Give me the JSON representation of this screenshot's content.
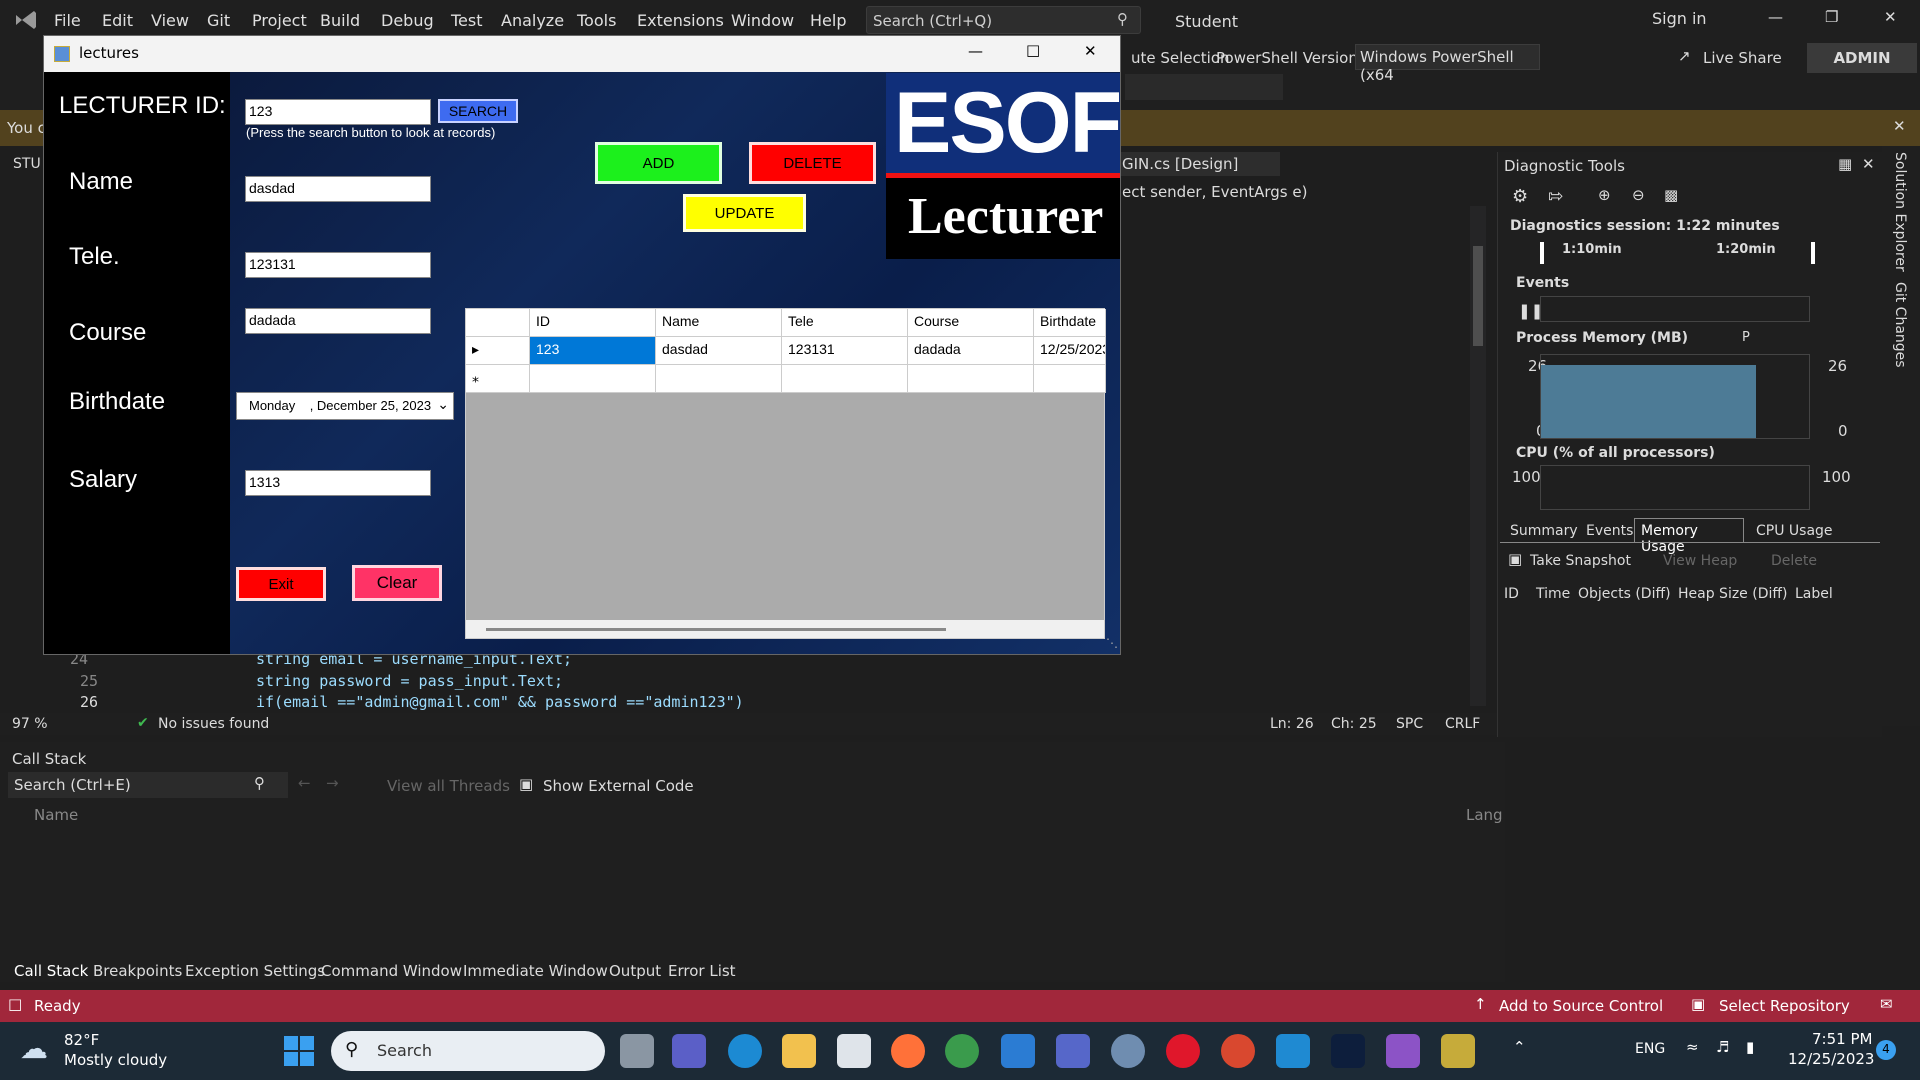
{
  "vs": {
    "menu": [
      "File",
      "Edit",
      "View",
      "Git",
      "Project",
      "Build",
      "Debug",
      "Test",
      "Analyze",
      "Tools",
      "Extensions",
      "Window",
      "Help"
    ],
    "search_placeholder": "Search (Ctrl+Q)",
    "solution_name": "Student",
    "sign_in": "Sign in",
    "admin_badge": "ADMIN",
    "toolbar": {
      "ute_selection": "ute Selection",
      "ps_version_label": "PowerShell Version:",
      "ps_version_value": "Windows PowerShell (x64",
      "live_share": "Live Share"
    },
    "info_bar_text": "You c",
    "tab_left": "STU",
    "doc_tab": "GIN.cs [Design]",
    "method_dropdown": "ect sender, EventArgs e)",
    "code": {
      "lines": [
        {
          "num": "24",
          "text": "string email = username_input.Text;"
        },
        {
          "num": "25",
          "text": "string password = pass_input.Text;"
        },
        {
          "num": "26",
          "text": "if(email ==\"admin@gmail.com\" && password ==\"admin123\")"
        }
      ]
    },
    "editor_status": {
      "zoom": "97 %",
      "issues": "No issues found",
      "ln": "Ln: 26",
      "ch": "Ch: 25",
      "spc": "SPC",
      "crlf": "CRLF"
    },
    "diagnostics": {
      "title": "Diagnostic Tools",
      "session": "Diagnostics session: 1:22 minutes",
      "tick1": "1:10min",
      "tick2": "1:20min",
      "events": "Events",
      "process_memory": "Process Memory (MB)",
      "mem_legend_p": "P",
      "mem_max": "26",
      "mem_min": "0",
      "cpu": "CPU (% of all processors)",
      "cpu_max": "100",
      "tabs": [
        "Summary",
        "Events",
        "Memory Usage",
        "CPU Usage"
      ],
      "take_snapshot": "Take Snapshot",
      "view_heap": "View Heap",
      "delete": "Delete",
      "columns": [
        "ID",
        "Time",
        "Objects (Diff)",
        "Heap Size (Diff)",
        "Label"
      ]
    },
    "side_tabs": [
      "Solution Explorer",
      "Git Changes"
    ],
    "callstack": {
      "title": "Call Stack",
      "search": "Search (Ctrl+E)",
      "view_all_threads": "View all Threads",
      "show_external": "Show External Code",
      "col_name": "Name",
      "col_lang": "Lang",
      "bottom_tabs": [
        "Call Stack",
        "Breakpoints",
        "Exception Settings",
        "Command Window",
        "Immediate Window",
        "Output",
        "Error List"
      ]
    },
    "statusbar": {
      "ready": "Ready",
      "add_source": "Add to Source Control",
      "select_repo": "Select Repository"
    }
  },
  "form": {
    "title": "lectures",
    "labels": {
      "lecturer_id": "LECTURER ID:",
      "name": "Name",
      "tele": "Tele.",
      "course": "Course",
      "birthdate": "Birthdate",
      "salary": "Salary"
    },
    "values": {
      "id": "123",
      "name": "dasdad",
      "tele": "123131",
      "course": "dadada",
      "birthdate": "Monday    , December 25, 2023",
      "salary": "1313"
    },
    "hint": "(Press the search button to look at records)",
    "buttons": {
      "search": "SEARCH",
      "add": "ADD",
      "delete": "DELETE",
      "update": "UPDATE",
      "exit": "Exit",
      "clear": "Clear"
    },
    "banner": {
      "top": "ESOF",
      "bottom": "Lecturer"
    },
    "grid": {
      "columns": [
        "ID",
        "Name",
        "Tele",
        "Course",
        "Birthdate"
      ],
      "row": [
        "123",
        "dasdad",
        "123131",
        "dadada",
        "12/25/2023"
      ]
    }
  },
  "taskbar": {
    "weather_temp": "82°F",
    "weather_desc": "Mostly cloudy",
    "search": "Search",
    "lang": "ENG",
    "time": "7:51 PM",
    "date": "12/25/2023",
    "notif_count": "4"
  }
}
